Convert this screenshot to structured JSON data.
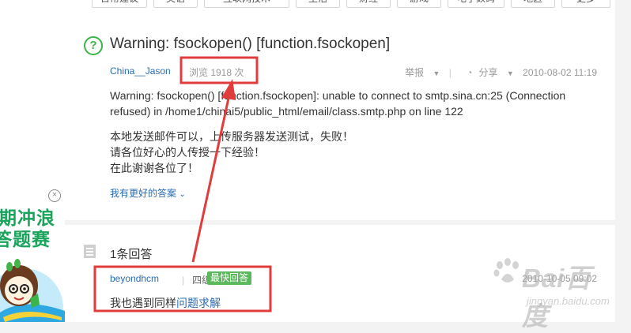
{
  "ad": {
    "close_glyph": "×",
    "line1": "期冲浪",
    "line2": "答题赛"
  },
  "tabs": [
    {
      "label": "日常建议"
    },
    {
      "label": "英语"
    },
    {
      "label": "互联网技术"
    },
    {
      "label": "生活"
    },
    {
      "label": "财经"
    },
    {
      "label": "游戏"
    },
    {
      "label": "电子数码"
    },
    {
      "label": "地区"
    },
    {
      "label": "更多"
    }
  ],
  "question": {
    "icon": "question-circle-icon",
    "title": "Warning: fsockopen() [function.fsockopen]",
    "author": "China__Jason",
    "views": "浏览 1918 次",
    "report": "举报",
    "share": "分享",
    "date": "2010-08-02 11:19",
    "body_en": "Warning: fsockopen() [function.fsockopen]: unable to connect to smtp.sina.cn:25 (Connection refused) in /home1/chinai5/public_html/email/class.smtp.php on line 122",
    "body_cn": [
      "本地发送邮件可以，上传服务器发送测试，失败！",
      "请各位好心的人传授一下经验！",
      "在此谢谢各位了！"
    ],
    "better_answer": "我有更好的答案"
  },
  "answers": {
    "title": "1条回答",
    "user": "beyondhcm",
    "level": "四级",
    "badge": "最快回答",
    "date": "2010-10-05 09:02",
    "text_prefix": "我也遇到同样",
    "text_link": "问题求解"
  },
  "watermark": {
    "main": "Bai百度",
    "sub": "jingyan.baidu.com"
  },
  "colors": {
    "accent_green": "#3bb54a",
    "link_blue": "#2b6cb0",
    "annotation_red": "#e03c3c",
    "badge_green": "#5cb85c"
  }
}
